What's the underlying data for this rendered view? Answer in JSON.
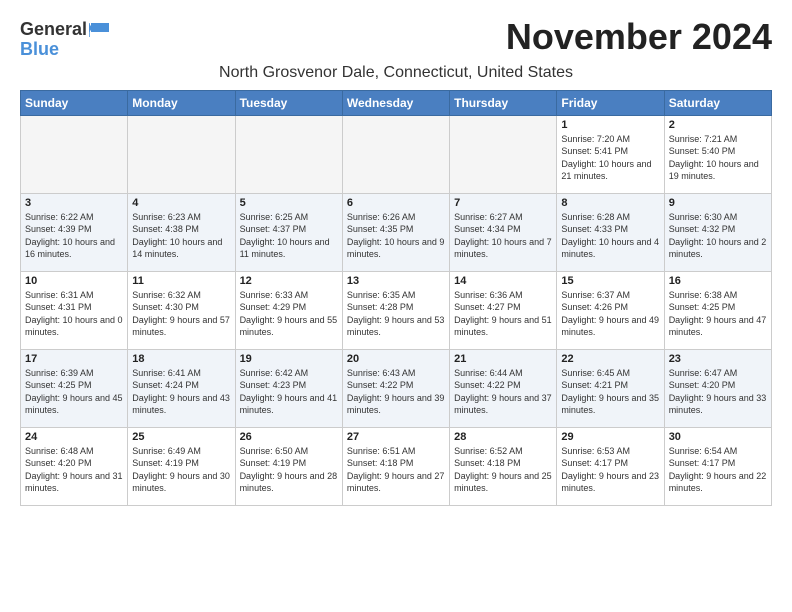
{
  "logo": {
    "general": "General",
    "blue": "Blue"
  },
  "title": "November 2024",
  "subtitle": "North Grosvenor Dale, Connecticut, United States",
  "days_of_week": [
    "Sunday",
    "Monday",
    "Tuesday",
    "Wednesday",
    "Thursday",
    "Friday",
    "Saturday"
  ],
  "weeks": [
    [
      {
        "day": "",
        "info": ""
      },
      {
        "day": "",
        "info": ""
      },
      {
        "day": "",
        "info": ""
      },
      {
        "day": "",
        "info": ""
      },
      {
        "day": "",
        "info": ""
      },
      {
        "day": "1",
        "info": "Sunrise: 7:20 AM\nSunset: 5:41 PM\nDaylight: 10 hours and 21 minutes."
      },
      {
        "day": "2",
        "info": "Sunrise: 7:21 AM\nSunset: 5:40 PM\nDaylight: 10 hours and 19 minutes."
      }
    ],
    [
      {
        "day": "3",
        "info": "Sunrise: 6:22 AM\nSunset: 4:39 PM\nDaylight: 10 hours and 16 minutes."
      },
      {
        "day": "4",
        "info": "Sunrise: 6:23 AM\nSunset: 4:38 PM\nDaylight: 10 hours and 14 minutes."
      },
      {
        "day": "5",
        "info": "Sunrise: 6:25 AM\nSunset: 4:37 PM\nDaylight: 10 hours and 11 minutes."
      },
      {
        "day": "6",
        "info": "Sunrise: 6:26 AM\nSunset: 4:35 PM\nDaylight: 10 hours and 9 minutes."
      },
      {
        "day": "7",
        "info": "Sunrise: 6:27 AM\nSunset: 4:34 PM\nDaylight: 10 hours and 7 minutes."
      },
      {
        "day": "8",
        "info": "Sunrise: 6:28 AM\nSunset: 4:33 PM\nDaylight: 10 hours and 4 minutes."
      },
      {
        "day": "9",
        "info": "Sunrise: 6:30 AM\nSunset: 4:32 PM\nDaylight: 10 hours and 2 minutes."
      }
    ],
    [
      {
        "day": "10",
        "info": "Sunrise: 6:31 AM\nSunset: 4:31 PM\nDaylight: 10 hours and 0 minutes."
      },
      {
        "day": "11",
        "info": "Sunrise: 6:32 AM\nSunset: 4:30 PM\nDaylight: 9 hours and 57 minutes."
      },
      {
        "day": "12",
        "info": "Sunrise: 6:33 AM\nSunset: 4:29 PM\nDaylight: 9 hours and 55 minutes."
      },
      {
        "day": "13",
        "info": "Sunrise: 6:35 AM\nSunset: 4:28 PM\nDaylight: 9 hours and 53 minutes."
      },
      {
        "day": "14",
        "info": "Sunrise: 6:36 AM\nSunset: 4:27 PM\nDaylight: 9 hours and 51 minutes."
      },
      {
        "day": "15",
        "info": "Sunrise: 6:37 AM\nSunset: 4:26 PM\nDaylight: 9 hours and 49 minutes."
      },
      {
        "day": "16",
        "info": "Sunrise: 6:38 AM\nSunset: 4:25 PM\nDaylight: 9 hours and 47 minutes."
      }
    ],
    [
      {
        "day": "17",
        "info": "Sunrise: 6:39 AM\nSunset: 4:25 PM\nDaylight: 9 hours and 45 minutes."
      },
      {
        "day": "18",
        "info": "Sunrise: 6:41 AM\nSunset: 4:24 PM\nDaylight: 9 hours and 43 minutes."
      },
      {
        "day": "19",
        "info": "Sunrise: 6:42 AM\nSunset: 4:23 PM\nDaylight: 9 hours and 41 minutes."
      },
      {
        "day": "20",
        "info": "Sunrise: 6:43 AM\nSunset: 4:22 PM\nDaylight: 9 hours and 39 minutes."
      },
      {
        "day": "21",
        "info": "Sunrise: 6:44 AM\nSunset: 4:22 PM\nDaylight: 9 hours and 37 minutes."
      },
      {
        "day": "22",
        "info": "Sunrise: 6:45 AM\nSunset: 4:21 PM\nDaylight: 9 hours and 35 minutes."
      },
      {
        "day": "23",
        "info": "Sunrise: 6:47 AM\nSunset: 4:20 PM\nDaylight: 9 hours and 33 minutes."
      }
    ],
    [
      {
        "day": "24",
        "info": "Sunrise: 6:48 AM\nSunset: 4:20 PM\nDaylight: 9 hours and 31 minutes."
      },
      {
        "day": "25",
        "info": "Sunrise: 6:49 AM\nSunset: 4:19 PM\nDaylight: 9 hours and 30 minutes."
      },
      {
        "day": "26",
        "info": "Sunrise: 6:50 AM\nSunset: 4:19 PM\nDaylight: 9 hours and 28 minutes."
      },
      {
        "day": "27",
        "info": "Sunrise: 6:51 AM\nSunset: 4:18 PM\nDaylight: 9 hours and 27 minutes."
      },
      {
        "day": "28",
        "info": "Sunrise: 6:52 AM\nSunset: 4:18 PM\nDaylight: 9 hours and 25 minutes."
      },
      {
        "day": "29",
        "info": "Sunrise: 6:53 AM\nSunset: 4:17 PM\nDaylight: 9 hours and 23 minutes."
      },
      {
        "day": "30",
        "info": "Sunrise: 6:54 AM\nSunset: 4:17 PM\nDaylight: 9 hours and 22 minutes."
      }
    ]
  ]
}
